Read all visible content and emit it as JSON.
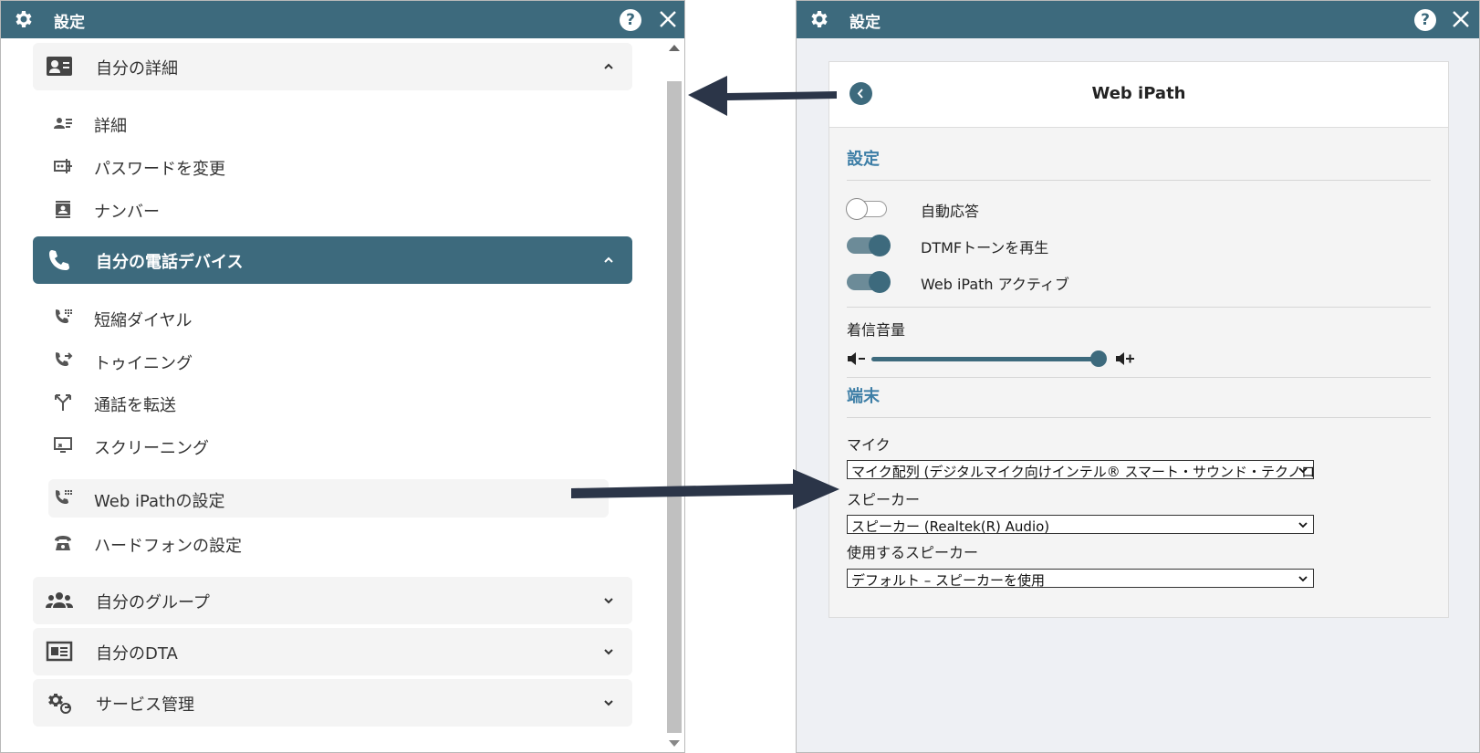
{
  "left": {
    "title": "設定",
    "help": "?",
    "sections": [
      {
        "label": "自分の詳細",
        "items": [
          "詳細",
          "パスワードを変更",
          "ナンバー"
        ]
      },
      {
        "label": "自分の電話デバイス",
        "items": [
          "短縮ダイヤル",
          "トゥイニング",
          "通話を転送",
          "スクリーニング",
          "Web iPathの設定",
          "ハードフォンの設定"
        ]
      },
      {
        "label": "自分のグループ"
      },
      {
        "label": "自分のDTA"
      },
      {
        "label": "サービス管理"
      }
    ]
  },
  "right": {
    "title": "設定",
    "help": "?",
    "card_title": "Web iPath",
    "settings_title": "設定",
    "toggles": [
      {
        "label": "自動応答",
        "on": false
      },
      {
        "label": "DTMFトーンを再生",
        "on": true
      },
      {
        "label": "Web iPath アクティブ",
        "on": true
      }
    ],
    "volume_label": "着信音量",
    "volume_level": 0.95,
    "terminal_title": "端末",
    "mic_label": "マイク",
    "mic_value": "マイク配列 (デジタルマイク向けインテル® スマート・サウンド・テクノロジー)",
    "speaker_label": "スピーカー",
    "speaker_value": "スピーカー (Realtek(R) Audio)",
    "use_speaker_label": "使用するスピーカー",
    "use_speaker_value": "デフォルト – スピーカーを使用"
  },
  "colors": {
    "header": "#3d6a7d",
    "accent_text": "#3d7ea6",
    "arrow": "#2b3548"
  }
}
